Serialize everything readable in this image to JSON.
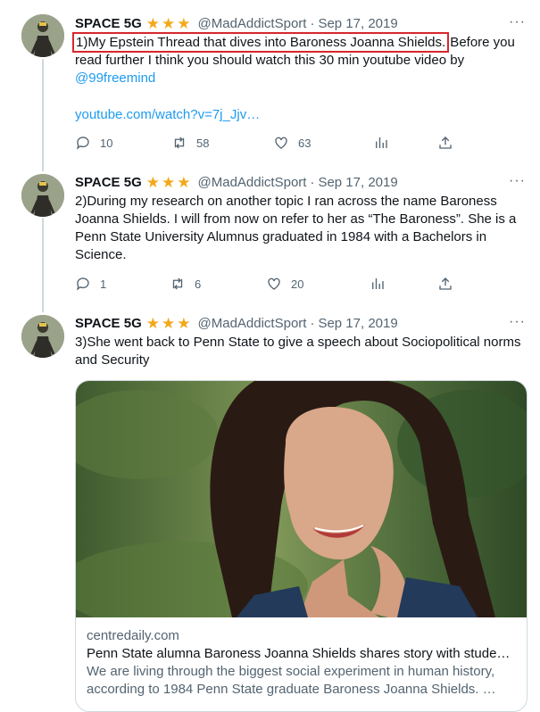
{
  "tweets": [
    {
      "name": "SPACE 5G",
      "handle": "@MadAddictSport",
      "separator": "·",
      "date": "Sep 17, 2019",
      "more": "···",
      "text_highlight": "1)My Epstein Thread that dives into Baroness Joanna Shields.",
      "text_rest": " Before you read further I think you should watch this 30 min youtube video by ",
      "mention": "@99freemind",
      "link": "youtube.com/watch?v=7j_Jjv…",
      "replies": "10",
      "retweets": "58",
      "likes": "63"
    },
    {
      "name": "SPACE 5G",
      "handle": "@MadAddictSport",
      "separator": "·",
      "date": "Sep 17, 2019",
      "more": "···",
      "text": "2)During my research on another topic I ran across the name Baroness Joanna Shields. I will from now on refer to her as “The Baroness”. She is a Penn State University Alumnus graduated in 1984 with a Bachelors in Science.",
      "replies": "1",
      "retweets": "6",
      "likes": "20"
    },
    {
      "name": "SPACE 5G",
      "handle": "@MadAddictSport",
      "separator": "·",
      "date": "Sep 17, 2019",
      "more": "···",
      "text": "3)She went back to Penn State to give a speech about Sociopolitical norms and Security",
      "card": {
        "domain": "centredaily.com",
        "title": "Penn State alumna Baroness Joanna Shields shares story with stude…",
        "description": "We are living through the biggest social experiment in human history, according to 1984 Penn State graduate Baroness Joanna Shields. …"
      }
    }
  ],
  "colors": {
    "star": "#f3a81b",
    "link": "#1d9bf0",
    "highlight_box": "#d8262e",
    "thread_line": "#cfd9de"
  },
  "icons": [
    "reply-icon",
    "retweet-icon",
    "like-icon",
    "views-icon",
    "share-icon",
    "more-icon",
    "star-badge-icon"
  ]
}
